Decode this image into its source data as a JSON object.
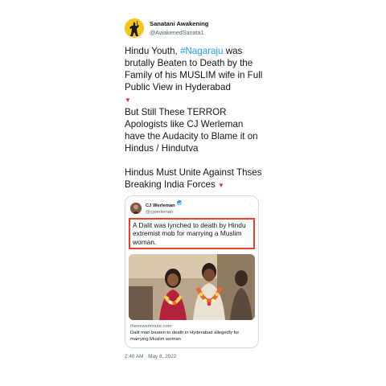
{
  "author": {
    "display_name": "Sanatani Awakening",
    "handle": "@AwakenedSanata1"
  },
  "tweet": {
    "line1_before": "Hindu Youth, ",
    "hashtag": "#Nagaraju",
    "line1_after": " was brutally Beaten to Death by the Family of his MUSLIM wife in Full Public View in Hyderabad",
    "emoji_1": "▼",
    "para2": "But Still These TERROR Apologists like CJ Werleman have the Audacity to Blame it on Hindus / Hindutva",
    "para3": "Hindus Must Unite Against Thses Breaking India Forces",
    "emoji_2": "▼",
    "timestamp": "2:40 AM · May 8, 2022"
  },
  "quoted": {
    "display_name": "CJ Werleman",
    "handle": "@cjwerleman",
    "text": "A Dalit was lynched to death by Hindu extremist mob for marrying a Muslim woman.",
    "more_icon": "⋮",
    "link_domain": "thenewsminute.com",
    "link_title": "Dalit man beaten to death in Hyderabad allegedly for marrying Muslim woman"
  },
  "colors": {
    "hashtag": "#1d9bf0",
    "highlight_border": "#e8432a",
    "avatar_bg": "#f5c518"
  },
  "icons": {
    "author_avatar": "warrior-silhouette-icon",
    "verified": "verified-badge-icon",
    "more": "more-options-icon"
  }
}
